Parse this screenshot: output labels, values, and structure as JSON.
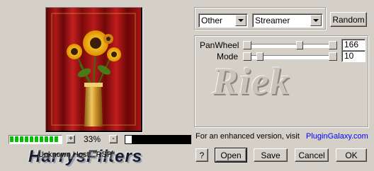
{
  "preview": {
    "zoom_minus": "-",
    "zoom_plus": "+",
    "zoom_value": "33%",
    "progress_fraction": 1.0
  },
  "branding": {
    "logo_text": "HarrysFilters",
    "status_text": "Unknown Host: \"RSP\""
  },
  "filter": {
    "category": "Other",
    "name": "Streamer",
    "random_label": "Random"
  },
  "params": [
    {
      "label": "PanWheel",
      "value": "166"
    },
    {
      "label": "Mode",
      "value": "10"
    }
  ],
  "watermark": "Riek",
  "promo": {
    "text": "For an enhanced version, visit",
    "link": "PluginGalaxy.com"
  },
  "buttons": {
    "help": "?",
    "open": "Open",
    "save": "Save",
    "cancel": "Cancel",
    "ok": "OK"
  },
  "colors": {
    "link": "#0000ff",
    "progress": "#00c000",
    "curtain": "#a01010"
  }
}
